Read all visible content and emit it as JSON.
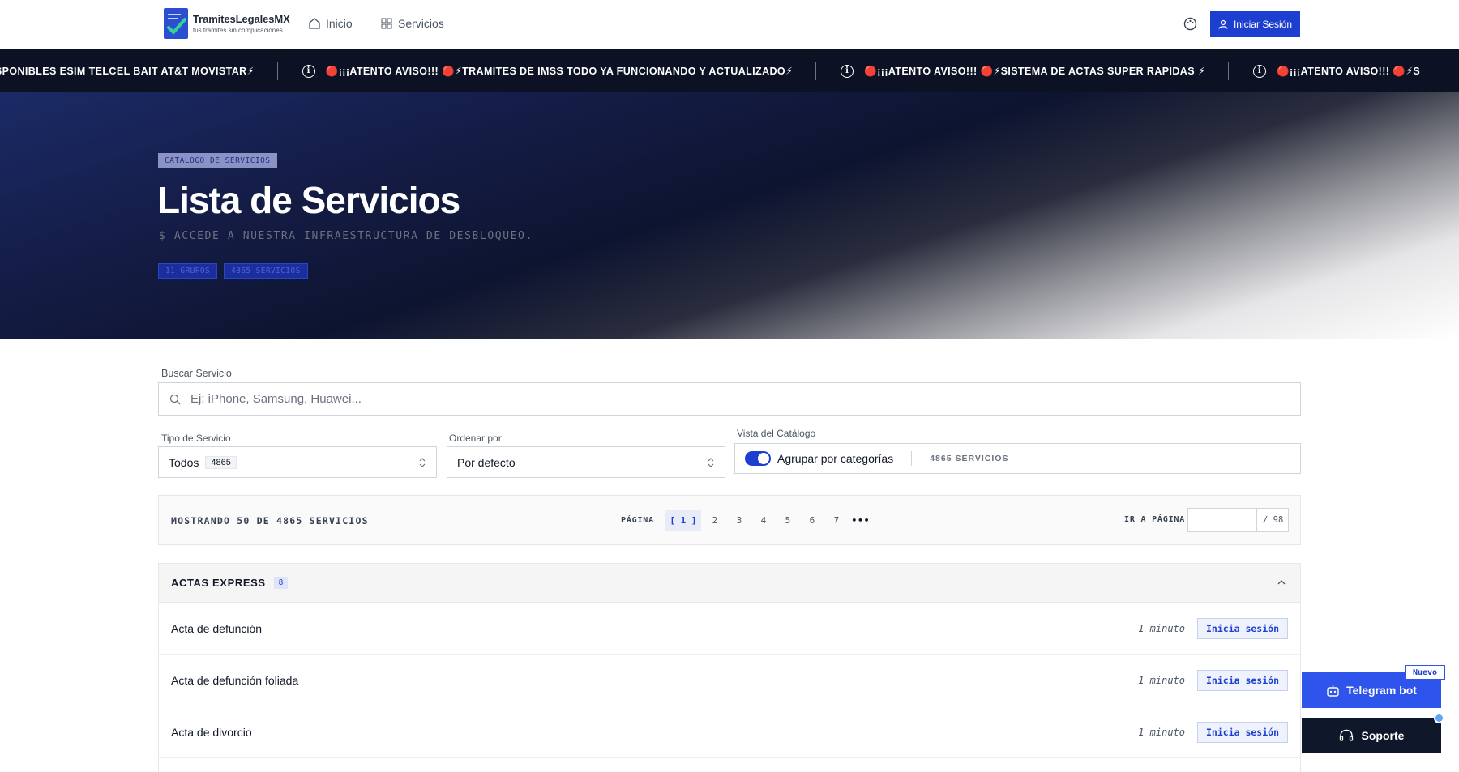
{
  "brand": {
    "name": "TramitesLegalesMX",
    "tagline": "tus trámites sin complicaciones"
  },
  "nav": {
    "inicio": "Inicio",
    "servicios": "Servicios",
    "login": "Iniciar Sesión"
  },
  "ticker": {
    "first": "ISPONIBLES ESIM TELCEL BAIT AT&T MOVISTAR⚡",
    "items": [
      "🔴¡¡¡ATENTO AVISO!!! 🔴⚡TRAMITES DE IMSS TODO YA FUNCIONANDO Y ACTUALIZADO⚡",
      "🔴¡¡¡ATENTO AVISO!!! 🔴⚡SISTEMA DE ACTAS SUPER RAPIDAS ⚡",
      "🔴¡¡¡ATENTO AVISO!!! 🔴⚡S"
    ]
  },
  "hero": {
    "badge": "CATÁLOGO DE SERVICIOS",
    "title": "Lista de Servicios",
    "subtitle": "$ ACCEDE A NUESTRA INFRAESTRUCTURA DE DESBLOQUEO.",
    "chips": [
      "11 GRUPOS",
      "4865 SERVICIOS"
    ]
  },
  "search": {
    "label": "Buscar Servicio",
    "placeholder": "Ej: iPhone, Samsung, Huawei..."
  },
  "filters": {
    "tipo_label": "Tipo de Servicio",
    "tipo_value": "Todos",
    "tipo_count": "4865",
    "orden_label": "Ordenar por",
    "orden_value": "Por defecto",
    "vista_label": "Vista del Catálogo",
    "vista_toggle": "Agrupar por categorías",
    "vista_count": "4865 SERVICIOS"
  },
  "pagination": {
    "info": "MOSTRANDO 50 DE 4865 SERVICIOS",
    "label": "PÁGINA",
    "active": "[ 1 ]",
    "pages": [
      "2",
      "3",
      "4",
      "5",
      "6",
      "7"
    ],
    "more": "•••",
    "goto_label": "IR A PÁGINA",
    "total": "/ 98"
  },
  "category": {
    "title": "ACTAS EXPRESS",
    "count": "8",
    "services": [
      {
        "name": "Acta de defunción",
        "time": "1 minuto",
        "action": "Inicia sesión"
      },
      {
        "name": "Acta de defunción foliada",
        "time": "1 minuto",
        "action": "Inicia sesión"
      },
      {
        "name": "Acta de divorcio",
        "time": "1 minuto",
        "action": "Inicia sesión"
      }
    ]
  },
  "floating": {
    "telegram": "Telegram bot",
    "badge": "Nuevo",
    "support": "Soporte"
  },
  "colors": {
    "primary": "#1d3fcf",
    "dark": "#0c1224",
    "telegram": "#2f54eb"
  }
}
